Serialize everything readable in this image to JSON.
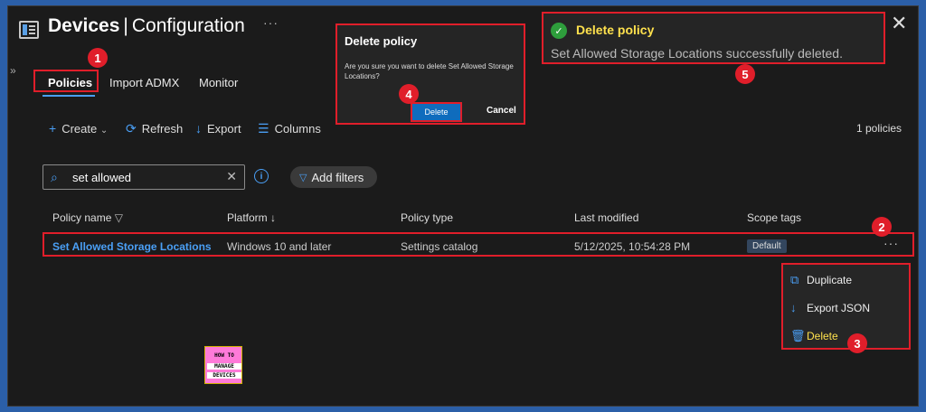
{
  "header": {
    "title_bold": "Devices",
    "title_sep": "|",
    "title_rest": "Configuration",
    "more": "···"
  },
  "tabs": [
    {
      "label": "Policies",
      "active": true
    },
    {
      "label": "Import ADMX",
      "active": false
    },
    {
      "label": "Monitor",
      "active": false
    }
  ],
  "toolbar": {
    "create_label": "Create",
    "refresh_label": "Refresh",
    "export_label": "Export",
    "columns_label": "Columns",
    "count_label": "1 policies"
  },
  "search": {
    "value": "set allowed"
  },
  "filter": {
    "label": "Add filters"
  },
  "table": {
    "columns": [
      "Policy name",
      "Platform ↓",
      "Policy type",
      "Last modified",
      "Scope tags"
    ],
    "rows": [
      {
        "policy_name": "Set Allowed Storage Locations",
        "platform": "Windows 10 and later",
        "policy_type": "Settings catalog",
        "last_modified": "5/12/2025, 10:54:28 PM",
        "scope_tags": "Default"
      }
    ]
  },
  "context_menu": {
    "items": [
      {
        "label": "Duplicate",
        "icon": "duplicate-icon"
      },
      {
        "label": "Export JSON",
        "icon": "download-icon"
      },
      {
        "label": "Delete",
        "icon": "trash-icon"
      }
    ]
  },
  "dialog": {
    "title": "Delete policy",
    "message": "Are you sure you want to delete Set Allowed Storage Locations?",
    "delete_label": "Delete",
    "cancel_label": "Cancel"
  },
  "toast": {
    "title": "Delete policy",
    "message": "Set Allowed Storage Locations successfully deleted."
  },
  "annotations": [
    "1",
    "2",
    "3",
    "4",
    "5"
  ],
  "logo": {
    "line1": "HOW TO",
    "line2": "MANAGE",
    "line3": "DEVICES"
  },
  "colors": {
    "accent": "#4a9ff5",
    "highlight": "#ffe14d",
    "callout": "#e01e2a",
    "success": "#2e9e3c"
  }
}
